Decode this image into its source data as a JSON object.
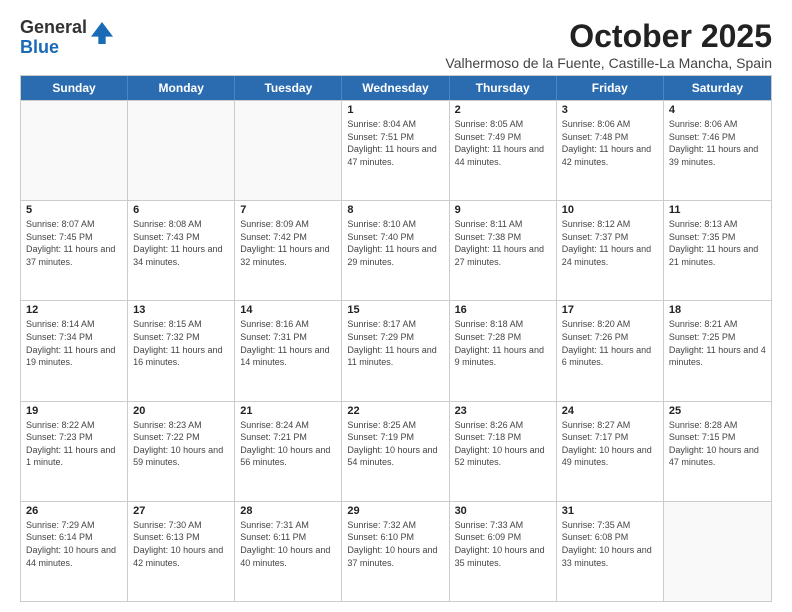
{
  "logo": {
    "general": "General",
    "blue": "Blue"
  },
  "title": "October 2025",
  "location": "Valhermoso de la Fuente, Castille-La Mancha, Spain",
  "header_days": [
    "Sunday",
    "Monday",
    "Tuesday",
    "Wednesday",
    "Thursday",
    "Friday",
    "Saturday"
  ],
  "weeks": [
    [
      {
        "day": "",
        "info": ""
      },
      {
        "day": "",
        "info": ""
      },
      {
        "day": "",
        "info": ""
      },
      {
        "day": "1",
        "info": "Sunrise: 8:04 AM\nSunset: 7:51 PM\nDaylight: 11 hours and 47 minutes."
      },
      {
        "day": "2",
        "info": "Sunrise: 8:05 AM\nSunset: 7:49 PM\nDaylight: 11 hours and 44 minutes."
      },
      {
        "day": "3",
        "info": "Sunrise: 8:06 AM\nSunset: 7:48 PM\nDaylight: 11 hours and 42 minutes."
      },
      {
        "day": "4",
        "info": "Sunrise: 8:06 AM\nSunset: 7:46 PM\nDaylight: 11 hours and 39 minutes."
      }
    ],
    [
      {
        "day": "5",
        "info": "Sunrise: 8:07 AM\nSunset: 7:45 PM\nDaylight: 11 hours and 37 minutes."
      },
      {
        "day": "6",
        "info": "Sunrise: 8:08 AM\nSunset: 7:43 PM\nDaylight: 11 hours and 34 minutes."
      },
      {
        "day": "7",
        "info": "Sunrise: 8:09 AM\nSunset: 7:42 PM\nDaylight: 11 hours and 32 minutes."
      },
      {
        "day": "8",
        "info": "Sunrise: 8:10 AM\nSunset: 7:40 PM\nDaylight: 11 hours and 29 minutes."
      },
      {
        "day": "9",
        "info": "Sunrise: 8:11 AM\nSunset: 7:38 PM\nDaylight: 11 hours and 27 minutes."
      },
      {
        "day": "10",
        "info": "Sunrise: 8:12 AM\nSunset: 7:37 PM\nDaylight: 11 hours and 24 minutes."
      },
      {
        "day": "11",
        "info": "Sunrise: 8:13 AM\nSunset: 7:35 PM\nDaylight: 11 hours and 21 minutes."
      }
    ],
    [
      {
        "day": "12",
        "info": "Sunrise: 8:14 AM\nSunset: 7:34 PM\nDaylight: 11 hours and 19 minutes."
      },
      {
        "day": "13",
        "info": "Sunrise: 8:15 AM\nSunset: 7:32 PM\nDaylight: 11 hours and 16 minutes."
      },
      {
        "day": "14",
        "info": "Sunrise: 8:16 AM\nSunset: 7:31 PM\nDaylight: 11 hours and 14 minutes."
      },
      {
        "day": "15",
        "info": "Sunrise: 8:17 AM\nSunset: 7:29 PM\nDaylight: 11 hours and 11 minutes."
      },
      {
        "day": "16",
        "info": "Sunrise: 8:18 AM\nSunset: 7:28 PM\nDaylight: 11 hours and 9 minutes."
      },
      {
        "day": "17",
        "info": "Sunrise: 8:20 AM\nSunset: 7:26 PM\nDaylight: 11 hours and 6 minutes."
      },
      {
        "day": "18",
        "info": "Sunrise: 8:21 AM\nSunset: 7:25 PM\nDaylight: 11 hours and 4 minutes."
      }
    ],
    [
      {
        "day": "19",
        "info": "Sunrise: 8:22 AM\nSunset: 7:23 PM\nDaylight: 11 hours and 1 minute."
      },
      {
        "day": "20",
        "info": "Sunrise: 8:23 AM\nSunset: 7:22 PM\nDaylight: 10 hours and 59 minutes."
      },
      {
        "day": "21",
        "info": "Sunrise: 8:24 AM\nSunset: 7:21 PM\nDaylight: 10 hours and 56 minutes."
      },
      {
        "day": "22",
        "info": "Sunrise: 8:25 AM\nSunset: 7:19 PM\nDaylight: 10 hours and 54 minutes."
      },
      {
        "day": "23",
        "info": "Sunrise: 8:26 AM\nSunset: 7:18 PM\nDaylight: 10 hours and 52 minutes."
      },
      {
        "day": "24",
        "info": "Sunrise: 8:27 AM\nSunset: 7:17 PM\nDaylight: 10 hours and 49 minutes."
      },
      {
        "day": "25",
        "info": "Sunrise: 8:28 AM\nSunset: 7:15 PM\nDaylight: 10 hours and 47 minutes."
      }
    ],
    [
      {
        "day": "26",
        "info": "Sunrise: 7:29 AM\nSunset: 6:14 PM\nDaylight: 10 hours and 44 minutes."
      },
      {
        "day": "27",
        "info": "Sunrise: 7:30 AM\nSunset: 6:13 PM\nDaylight: 10 hours and 42 minutes."
      },
      {
        "day": "28",
        "info": "Sunrise: 7:31 AM\nSunset: 6:11 PM\nDaylight: 10 hours and 40 minutes."
      },
      {
        "day": "29",
        "info": "Sunrise: 7:32 AM\nSunset: 6:10 PM\nDaylight: 10 hours and 37 minutes."
      },
      {
        "day": "30",
        "info": "Sunrise: 7:33 AM\nSunset: 6:09 PM\nDaylight: 10 hours and 35 minutes."
      },
      {
        "day": "31",
        "info": "Sunrise: 7:35 AM\nSunset: 6:08 PM\nDaylight: 10 hours and 33 minutes."
      },
      {
        "day": "",
        "info": ""
      }
    ]
  ]
}
